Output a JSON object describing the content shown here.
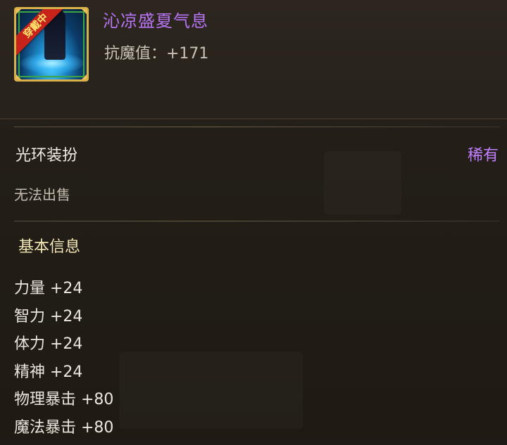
{
  "item": {
    "name": "沁凉盛夏气息",
    "stat_line": "抗魔值：+171",
    "equipped_badge": "穿戴中",
    "type": "光环装扮",
    "rarity": "稀有",
    "sell_status": "无法出售"
  },
  "basic_info": {
    "title": "基本信息",
    "attributes": [
      "力量 +24",
      "智力 +24",
      "体力 +24",
      "精神 +24",
      "物理暴击 +80",
      "魔法暴击 +80"
    ]
  },
  "colors": {
    "name": "#b673f2",
    "rarity": "#c27fff",
    "section_title": "#f3e7b6",
    "icon_border": "#d9b04a",
    "badge": "#c8231b"
  }
}
